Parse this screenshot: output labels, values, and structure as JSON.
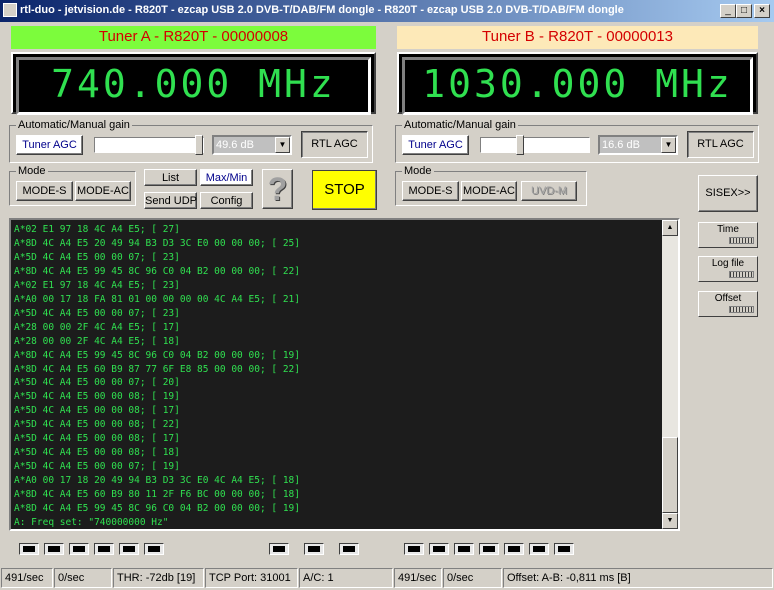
{
  "window": {
    "title": "rtl-duo - jetvision.de - R820T - ezcap USB 2.0 DVB-T/DAB/FM dongle - R820T - ezcap USB 2.0 DVB-T/DAB/FM dongle"
  },
  "tuner_a": {
    "header": "Tuner A - R820T - 00000008",
    "header_bg": "#7cfc3c",
    "frequency": "740.000 MHz",
    "gain_group": "Automatic/Manual gain",
    "tuner_agc": "Tuner AGC",
    "gain_level": 1.0,
    "gain_value": "49.6 dB",
    "rtl_agc": "RTL AGC"
  },
  "tuner_b": {
    "header": "Tuner B - R820T - 00000013",
    "header_bg": "#fde9b8",
    "frequency": "1030.000 MHz",
    "gain_group": "Automatic/Manual gain",
    "tuner_agc": "Tuner AGC",
    "gain_level": 0.35,
    "gain_value": "16.6 dB",
    "rtl_agc": "RTL AGC"
  },
  "mode_a": {
    "label": "Mode",
    "mode_s": "MODE-S",
    "mode_ac": "MODE-AC"
  },
  "mode_b": {
    "label": "Mode",
    "mode_s": "MODE-S",
    "mode_ac": "MODE-AC",
    "uvd_m": "UVD-M"
  },
  "controls": {
    "list": "List",
    "maxmin": "Max/Min",
    "send_udp": "Send UDP",
    "config": "Config",
    "help_icon": "question-mark-icon",
    "stop": "STOP",
    "stop_bg": "#ffff00",
    "sisex": "SISEX>>"
  },
  "side": {
    "time": "Time",
    "log_file": "Log file",
    "offset": "Offset"
  },
  "log": {
    "lines": [
      "A*02 E1 97 18 4C A4 E5; [ 27]",
      "A*8D 4C A4 E5 20 49 94 B3 D3 3C E0 00 00 00; [ 25]",
      "A*5D 4C A4 E5 00 00 07; [ 23]",
      "A*8D 4C A4 E5 99 45 8C 96 C0 04 B2 00 00 00; [ 22]",
      "A*02 E1 97 18 4C A4 E5; [ 23]",
      "A*A0 00 17 18 FA 81 01 00 00 00 00 4C A4 E5; [ 21]",
      "A*5D 4C A4 E5 00 00 07; [ 23]",
      "A*28 00 00 2F 4C A4 E5; [ 17]",
      "A*28 00 00 2F 4C A4 E5; [ 18]",
      "A*8D 4C A4 E5 99 45 8C 96 C0 04 B2 00 00 00; [ 19]",
      "A*8D 4C A4 E5 60 B9 87 77 6F E8 85 00 00 00; [ 22]",
      "A*5D 4C A4 E5 00 00 07; [ 20]",
      "A*5D 4C A4 E5 00 00 08; [ 19]",
      "A*5D 4C A4 E5 00 00 08; [ 17]",
      "A*5D 4C A4 E5 00 00 08; [ 22]",
      "A*5D 4C A4 E5 00 00 08; [ 17]",
      "A*5D 4C A4 E5 00 00 08; [ 18]",
      "A*5D 4C A4 E5 00 00 07; [ 19]",
      "A*A0 00 17 18 20 49 94 B3 D3 3C E0 4C A4 E5; [ 18]",
      "A*8D 4C A4 E5 60 B9 80 11 2F F6 BC 00 00 00; [ 18]",
      "A*8D 4C A4 E5 99 45 8C 96 C0 04 B2 00 00 00; [ 19]",
      "A: Freq set: \"740000000 Hz\""
    ],
    "scroll_position": 1.0
  },
  "status": {
    "rate_a": "491/sec",
    "rate_a2": "0/sec",
    "thr": "THR: -72db [19]",
    "tcp_port": "TCP Port: 31001",
    "ac": "A/C: 1",
    "rate_b": "491/sec",
    "rate_b2": "0/sec",
    "offset": "Offset: A-B: -0,811 ms [B]"
  }
}
